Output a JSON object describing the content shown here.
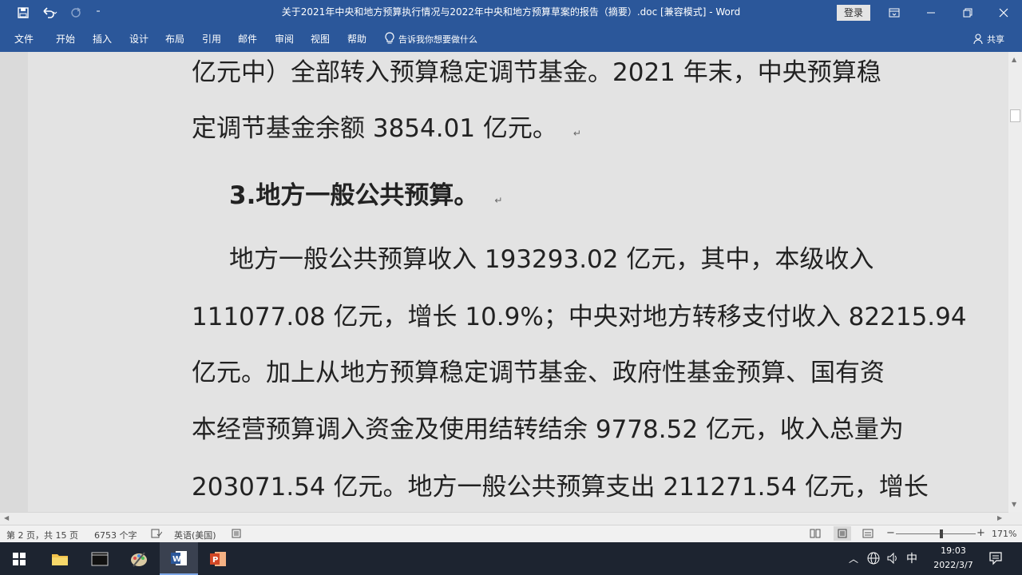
{
  "titlebar": {
    "document_title": "关于2021年中央和地方预算执行情况与2022年中央和地方预算草案的报告（摘要）.doc [兼容模式] - Word",
    "login_label": "登录",
    "icons": [
      "save-icon",
      "undo-icon",
      "redo-icon",
      "customize-quick-access-icon",
      "ribbon-display-icon",
      "minimize-icon",
      "restore-icon",
      "close-icon"
    ]
  },
  "ribbon": {
    "tabs": [
      "文件",
      "开始",
      "插入",
      "设计",
      "布局",
      "引用",
      "邮件",
      "审阅",
      "视图",
      "帮助"
    ],
    "tell_me": "告诉我你想要做什么",
    "share_label": "共享"
  },
  "document": {
    "lines": [
      "亿元中）全部转入预算稳定调节基金。2021 年末，中央预算稳",
      "定调节基金余额 3854.01 亿元。",
      "3.地方一般公共预算。",
      "地方一般公共预算收入 193293.02 亿元，其中，本级收入",
      "111077.08 亿元，增长 10.9%；中央对地方转移支付收入 82215.94",
      "亿元。加上从地方预算稳定调节基金、政府性基金预算、国有资",
      "本经营预算调入资金及使用结转结余 9778.52 亿元，收入总量为",
      "203071.54 亿元。地方一般公共预算支出 211271.54 亿元，增长"
    ],
    "paragraph_mark": "↵"
  },
  "statusbar": {
    "page": "第 2 页，共 15 页",
    "word_count": "6753 个字",
    "language": "英语(美国)",
    "zoom": "171%",
    "zoom_minus": "−",
    "zoom_plus": "+"
  },
  "taskbar": {
    "ime": "中",
    "time": "19:03",
    "date": "2022/3/7"
  }
}
